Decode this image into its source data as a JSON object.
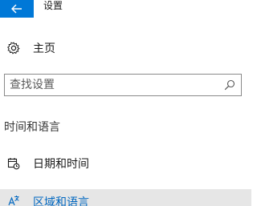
{
  "window": {
    "title": "设置"
  },
  "nav": {
    "home_label": "主页"
  },
  "search": {
    "placeholder": "查找设置"
  },
  "section": {
    "title": "时间和语言",
    "items": [
      {
        "label": "日期和时间",
        "icon": "calendar-clock-icon"
      },
      {
        "label": "区域和语言",
        "icon": "language-icon",
        "selected": true
      }
    ]
  },
  "colors": {
    "accent": "#0078d7",
    "selected_text": "#0067c0",
    "selected_bg": "#e6e6e6"
  }
}
